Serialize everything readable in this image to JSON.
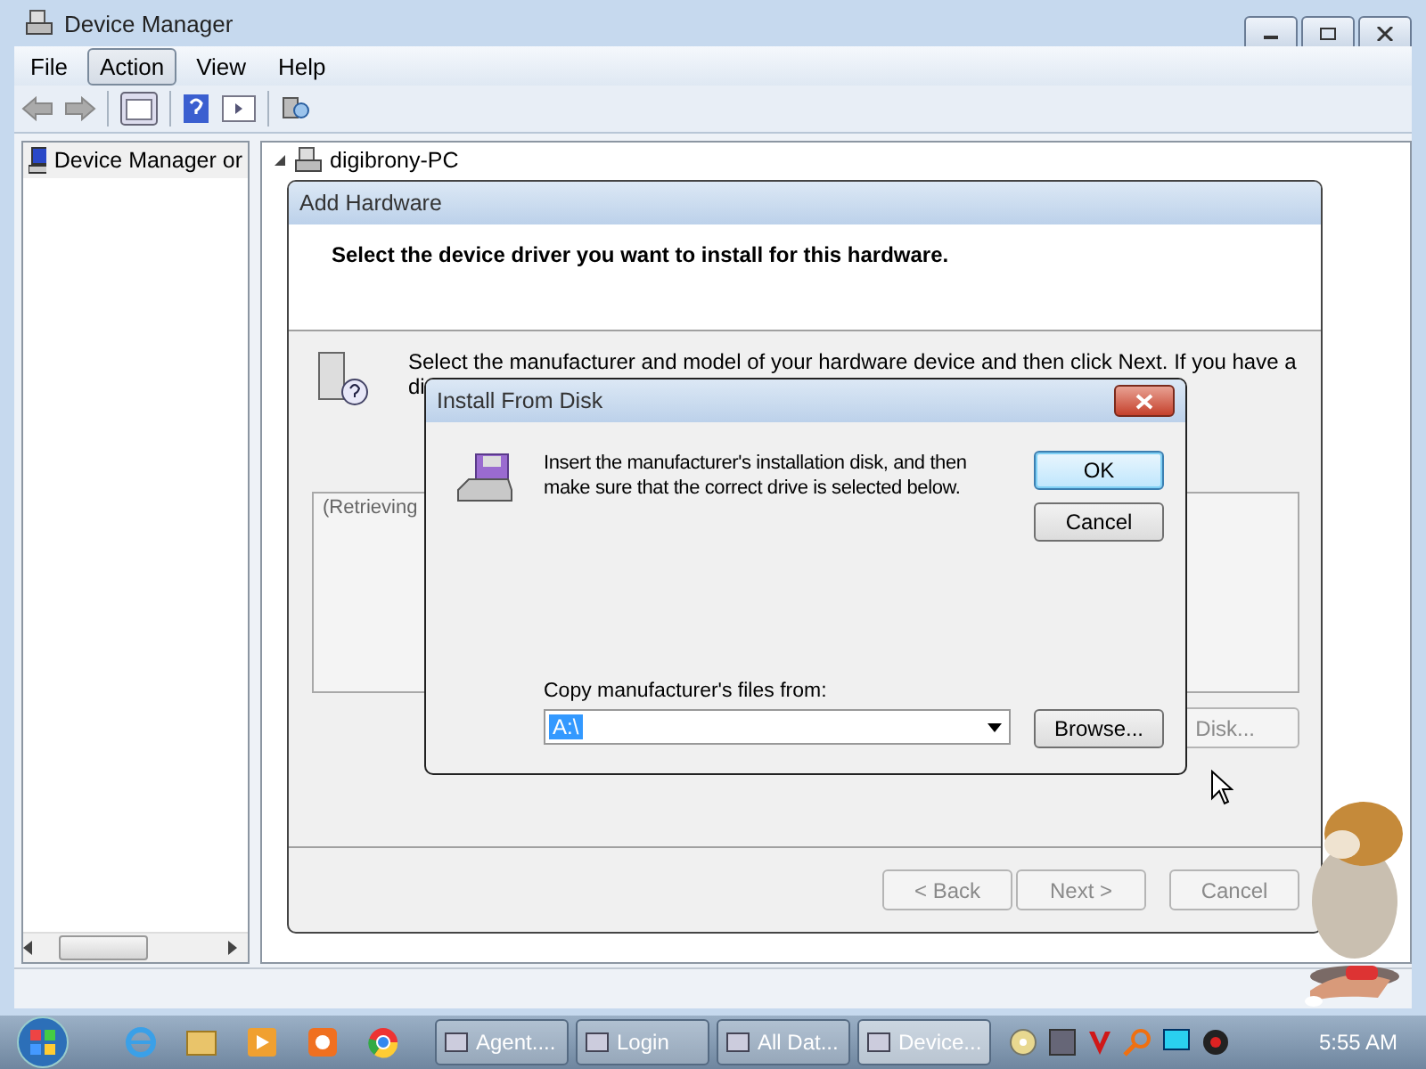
{
  "window": {
    "title": "Device Manager"
  },
  "menu": [
    {
      "label": "File",
      "selected": false
    },
    {
      "label": "Action",
      "selected": true
    },
    {
      "label": "View",
      "selected": false
    },
    {
      "label": "Help",
      "selected": false
    }
  ],
  "left_pane": {
    "items": [
      {
        "label": "Device Manager or"
      }
    ]
  },
  "tree": [
    {
      "label": "digibrony-PC",
      "expanded": true
    }
  ],
  "add_hardware": {
    "title": "Add Hardware",
    "heading": "Select the device driver you want to install for this hardware.",
    "instruction_line_1": "Select the manufacturer and model of your hardware device and then click Next. If you have a",
    "instruction_line_2": "di",
    "list_text": "(Retrieving",
    "have_disk_button": {
      "label": "Disk...",
      "disabled": true
    },
    "buttons": [
      {
        "label": "< Back",
        "disabled": true
      },
      {
        "label": "Next >",
        "disabled": true
      },
      {
        "label": "Cancel",
        "disabled": true
      }
    ]
  },
  "install_from_disk": {
    "title": "Install From Disk",
    "message": "Insert the manufacturer's installation disk, and then make sure that the correct drive is selected below.",
    "buttons": [
      {
        "label": "OK",
        "default": true
      },
      {
        "label": "Cancel",
        "default": false
      }
    ],
    "copy_label": "Copy manufacturer's files from:",
    "path_value": "A:\\",
    "browse_button": "Browse..."
  },
  "taskbar": {
    "tasks": [
      {
        "label": "Agent....",
        "selected": false
      },
      {
        "label": "Login",
        "selected": false
      },
      {
        "label": "All Dat...",
        "selected": false
      },
      {
        "label": "Device...",
        "selected": true
      }
    ],
    "clock": "5:55 AM"
  }
}
